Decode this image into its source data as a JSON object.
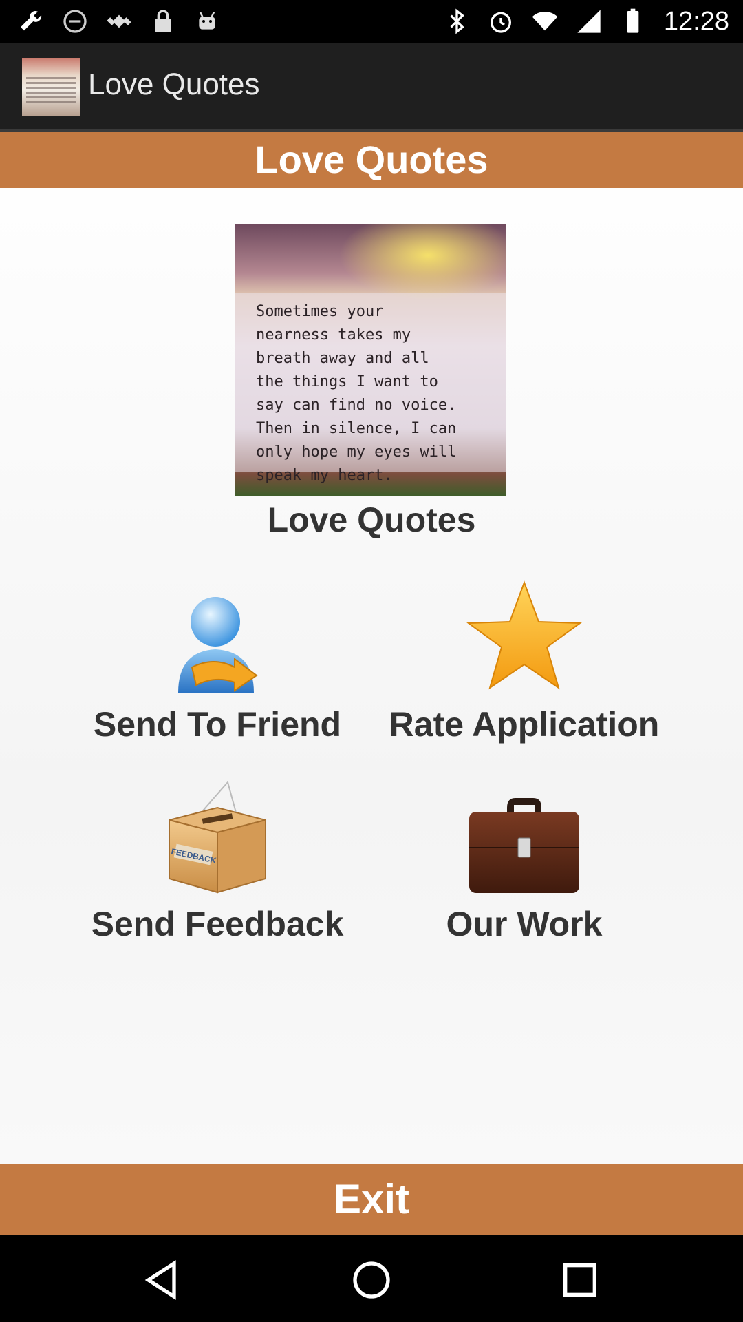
{
  "status_bar": {
    "left_icons": [
      "wrench-icon",
      "blocked-circle-icon",
      "fake-gps-icon",
      "lock-icon",
      "android-icon"
    ],
    "right_icons": [
      "bluetooth-icon",
      "alarm-icon",
      "wifi-icon",
      "signal-icon",
      "battery-icon"
    ],
    "time": "12:28"
  },
  "action_bar": {
    "title": "Love Quotes"
  },
  "header": {
    "title": "Love Quotes"
  },
  "quote_image": {
    "text": "Sometimes your\nnearness takes my\nbreath away and all\nthe things I want to\nsay can find no voice.\nThen in silence, I can\nonly hope my eyes will\nspeak my heart."
  },
  "caption": "Love Quotes",
  "menu": {
    "send_to_friend": "Send To Friend",
    "rate_application": "Rate Application",
    "send_feedback": "Send Feedback",
    "feedback_box_text": "FEEDBACK",
    "our_work": "Our Work"
  },
  "exit": "Exit",
  "colors": {
    "accent": "#c47a42",
    "action_bar": "#1f1f1f"
  }
}
